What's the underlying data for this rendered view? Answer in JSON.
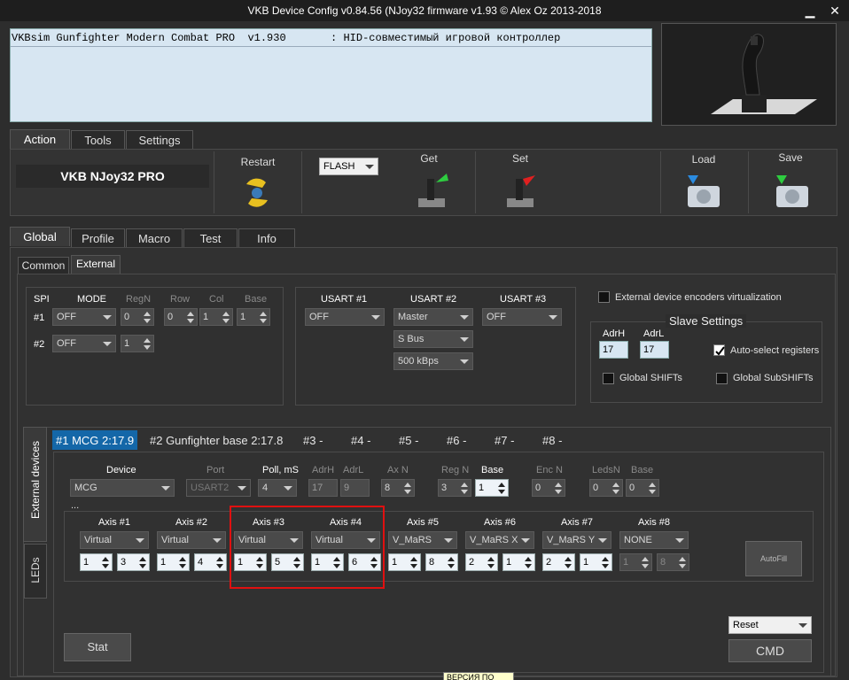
{
  "window": {
    "title": "VKB Device Config v0.84.56 (NJoy32 firmware v1.93 © Alex Oz 2013-2018",
    "minimize_glyph": "▁",
    "close_glyph": "✕"
  },
  "info": {
    "line": "VKBsim Gunfighter Modern Combat PRO  v1.930       : HID-совместимый игровой контроллер"
  },
  "top_tabs": [
    "Action",
    "Tools",
    "Settings"
  ],
  "toolbar": {
    "device_name": "VKB NJoy32 PRO",
    "restart_label": "Restart",
    "flash_value": "FLASH",
    "get_label": "Get",
    "set_label": "Set",
    "load_label": "Load",
    "save_label": "Save"
  },
  "section_tabs": [
    "Global",
    "Profile",
    "Macro",
    "Test",
    "Info"
  ],
  "sub_tabs": [
    "Common",
    "External"
  ],
  "spi": {
    "header": [
      "SPI",
      "MODE",
      "RegN",
      "Row",
      "Col",
      "Base"
    ],
    "row1": {
      "label": "#1",
      "mode": "OFF",
      "regn": "0",
      "row": "0",
      "col": "1",
      "base": "1"
    },
    "row2": {
      "label": "#2",
      "mode": "OFF",
      "regn": "1"
    }
  },
  "usart": {
    "headers": [
      "USART #1",
      "USART #2",
      "USART #3"
    ],
    "u1": "OFF",
    "u2": [
      "Master",
      "S Bus",
      "500 kBps"
    ],
    "u3": "OFF"
  },
  "encoders_label": "External device encoders virtualization",
  "slave": {
    "title": "Slave Settings",
    "adrh_label": "AdrH",
    "adrl_label": "AdrL",
    "adrh": "17",
    "adrl": "17",
    "auto_select": "Auto-select registers",
    "global_shifts": "Global SHIFTs",
    "global_subshifts": "Global SubSHIFTs"
  },
  "vertical_tabs": [
    "External devices",
    "LEDs"
  ],
  "device_tabs": [
    "#1 MCG 2:17.9",
    "#2 Gunfighter base 2:17.8",
    "#3 -",
    "#4 -",
    "#5 -",
    "#6 -",
    "#7 -",
    "#8 -"
  ],
  "device_row": {
    "headers": [
      "Device",
      "Port",
      "Poll, mS",
      "AdrH",
      "AdrL",
      "Ax N",
      "Reg N",
      "Base",
      "Enc N",
      "LedsN",
      "Base"
    ],
    "device": "MCG",
    "port": "USART2",
    "poll": "4",
    "adrh": "17",
    "adrl": "9",
    "axn": "8",
    "regn": "3",
    "base": "1",
    "encn": "0",
    "ledsn": "0",
    "base2": "0",
    "ellipsis": "..."
  },
  "axes": [
    {
      "name": "Axis #1",
      "type": "Virtual",
      "a": "1",
      "b": "3"
    },
    {
      "name": "Axis #2",
      "type": "Virtual",
      "a": "1",
      "b": "4"
    },
    {
      "name": "Axis #3",
      "type": "Virtual",
      "a": "1",
      "b": "5"
    },
    {
      "name": "Axis #4",
      "type": "Virtual",
      "a": "1",
      "b": "6"
    },
    {
      "name": "Axis #5",
      "type": "V_MaRS",
      "a": "1",
      "b": "8"
    },
    {
      "name": "Axis #6",
      "type": "V_MaRS X",
      "a": "2",
      "b": "1"
    },
    {
      "name": "Axis #7",
      "type": "V_MaRS Y",
      "a": "2",
      "b": "1"
    },
    {
      "name": "Axis #8",
      "type": "NONE",
      "a": "1",
      "b": "8"
    }
  ],
  "autofill_label": "AutoFill",
  "stat_label": "Stat",
  "reset_value": "Reset",
  "cmd_label": "CMD",
  "tooltip_text": "ВЕРСИЯ ПО",
  "colors": {
    "highlight_box": "#e01010",
    "selected_device_tab": "#1467a8"
  }
}
